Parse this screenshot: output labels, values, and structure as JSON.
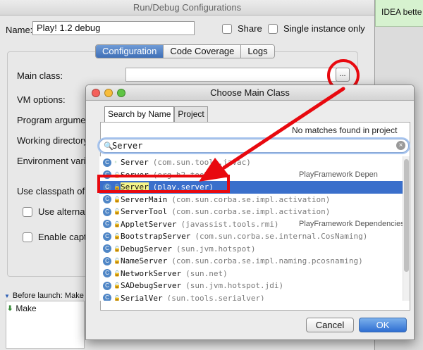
{
  "background_tooltip": "IDEA bette",
  "run_debug": {
    "title": "Run/Debug Configurations",
    "name_label": "Name:",
    "name_value": "Play! 1.2 debug",
    "share_label": "Share",
    "single_instance_label": "Single instance only",
    "tabs": [
      "Configuration",
      "Code Coverage",
      "Logs"
    ],
    "fields": {
      "main_class": "Main class:",
      "vm_options": "VM options:",
      "program_args": "Program argumen",
      "working_dir": "Working directory",
      "env_vars": "Environment varia",
      "use_classpath": "Use classpath of",
      "use_alternative": "Use alternativ",
      "enable_capture": "Enable captur"
    },
    "browse_button": "...",
    "before_launch": "Before launch: Make",
    "make_item": "Make"
  },
  "dialog": {
    "title": "Choose Main Class",
    "tabs": [
      "Search by Name",
      "Project"
    ],
    "status": "No matches found in project",
    "search_value": "Server",
    "results": [
      {
        "name": "Server",
        "pkg": "(com.sun.tools.javac)",
        "lib": ""
      },
      {
        "name": "Server",
        "pkg": "(org.h2.tools)",
        "lib": "PlayFramework Depen"
      },
      {
        "name": "Server",
        "pkg": "(play.server)",
        "lib": ""
      },
      {
        "name": "ServerMain",
        "pkg": "(com.sun.corba.se.impl.activation)",
        "lib": ""
      },
      {
        "name": "ServerTool",
        "pkg": "(com.sun.corba.se.impl.activation)",
        "lib": ""
      },
      {
        "name": "AppletServer",
        "pkg": "(javassist.tools.rmi)",
        "lib": "PlayFramework Dependencies"
      },
      {
        "name": "BootstrapServer",
        "pkg": "(com.sun.corba.se.internal.CosNaming)",
        "lib": ""
      },
      {
        "name": "DebugServer",
        "pkg": "(sun.jvm.hotspot)",
        "lib": ""
      },
      {
        "name": "NameServer",
        "pkg": "(com.sun.corba.se.impl.naming.pcosnaming)",
        "lib": ""
      },
      {
        "name": "NetworkServer",
        "pkg": "(sun.net)",
        "lib": ""
      },
      {
        "name": "SADebugServer",
        "pkg": "(sun.jvm.hotspot.jdi)",
        "lib": ""
      },
      {
        "name": "SerialVer",
        "pkg": "(sun.tools.serialver)",
        "lib": ""
      }
    ],
    "cancel_label": "Cancel",
    "ok_label": "OK"
  },
  "colors": {
    "annotation": "#e8090f",
    "selection": "#3a6fcb"
  }
}
